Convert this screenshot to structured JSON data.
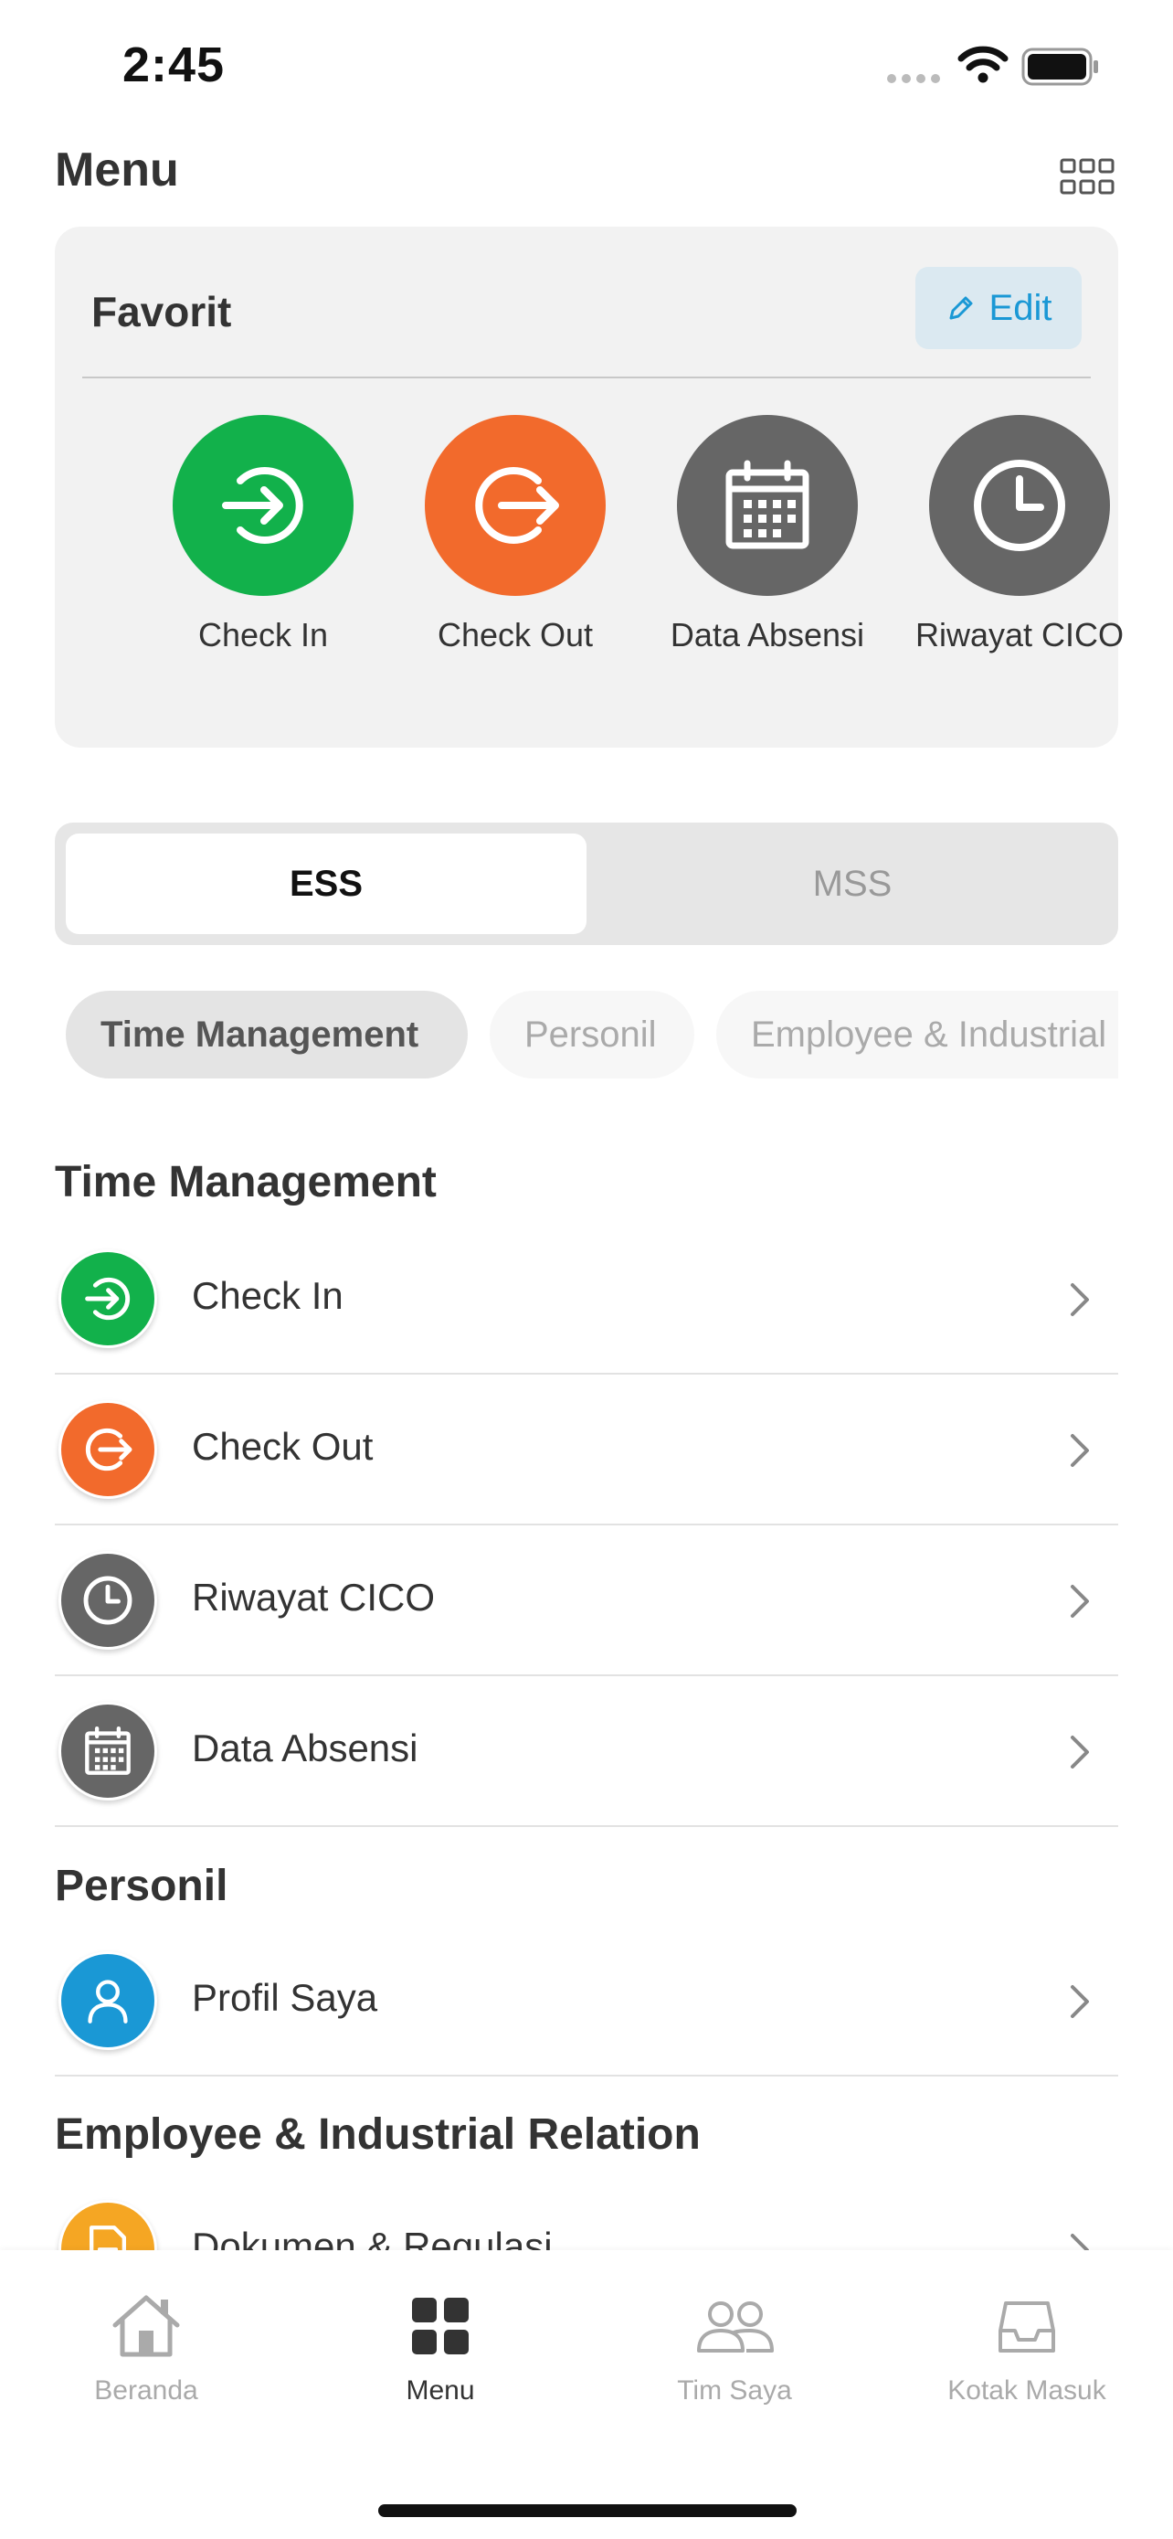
{
  "status_bar": {
    "time": "2:45"
  },
  "header": {
    "title": "Menu"
  },
  "favorites": {
    "title": "Favorit",
    "edit_label": "Edit",
    "items": [
      {
        "label": "Check In",
        "icon": "check-in-icon",
        "color": "#12b14b"
      },
      {
        "label": "Check Out",
        "icon": "check-out-icon",
        "color": "#f26a2c"
      },
      {
        "label": "Data Absensi",
        "icon": "calendar-icon",
        "color": "#666666"
      },
      {
        "label": "Riwayat CICO",
        "icon": "clock-icon",
        "color": "#666666"
      }
    ]
  },
  "segment": {
    "options": [
      "ESS",
      "MSS"
    ],
    "selected": "ESS"
  },
  "chips": [
    "Time Management",
    "Personil",
    "Employee & Industrial Relation"
  ],
  "sections": [
    {
      "title": "Time Management",
      "items": [
        {
          "label": "Check In",
          "icon": "check-in-icon",
          "color": "#12b14b"
        },
        {
          "label": "Check Out",
          "icon": "check-out-icon",
          "color": "#f26a2c"
        },
        {
          "label": "Riwayat CICO",
          "icon": "clock-icon",
          "color": "#666666"
        },
        {
          "label": "Data Absensi",
          "icon": "calendar-icon",
          "color": "#666666"
        }
      ]
    },
    {
      "title": "Personil",
      "items": [
        {
          "label": "Profil Saya",
          "icon": "user-icon",
          "color": "#1a98d5"
        }
      ]
    },
    {
      "title": "Employee & Industrial Relation",
      "items": [
        {
          "label": "Dokumen & Regulasi",
          "icon": "document-icon",
          "color": "#f5a623"
        }
      ]
    }
  ],
  "bottom_nav": [
    {
      "label": "Beranda",
      "icon": "home-icon"
    },
    {
      "label": "Menu",
      "icon": "grid-icon",
      "active": true
    },
    {
      "label": "Tim Saya",
      "icon": "team-icon"
    },
    {
      "label": "Kotak Masuk",
      "icon": "inbox-icon"
    }
  ],
  "colors": {
    "accent": "#1a98d5",
    "green": "#12b14b",
    "orange": "#f26a2c",
    "gray": "#666666"
  }
}
